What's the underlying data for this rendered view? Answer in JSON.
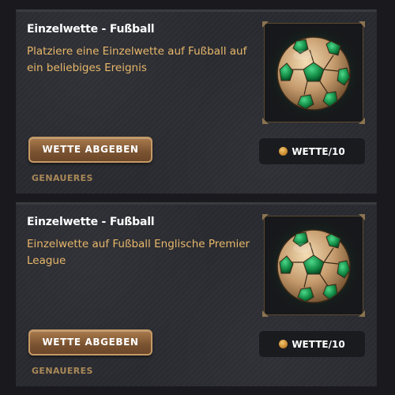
{
  "cards": [
    {
      "title": "Einzelwette - Fußball",
      "description": "Platziere eine Einzelwette auf Fußball auf ein beliebiges Ereignis",
      "place_bet_label": "WETTE ABGEBEN",
      "details_label": "GENAUERES",
      "cost_label": "WETTE/10",
      "image_icon": "soccer-ball-icon"
    },
    {
      "title": "Einzelwette - Fußball",
      "description": "Einzelwette auf Fußball Englische Premier League",
      "place_bet_label": "WETTE ABGEBEN",
      "details_label": "GENAUERES",
      "cost_label": "WETTE/10",
      "image_icon": "soccer-ball-icon"
    }
  ],
  "colors": {
    "accent_gold": "#e8b86a",
    "button_bronze": "#8a5f39",
    "card_bg": "#2a2b31",
    "badge_bg": "#1a1b1f"
  }
}
